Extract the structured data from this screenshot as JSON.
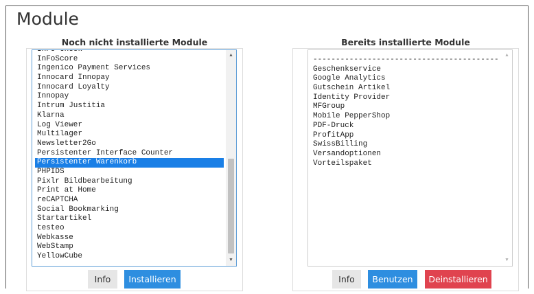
{
  "page": {
    "title": "Module"
  },
  "not_installed": {
    "heading": "Noch nicht installierte Module",
    "items": [
      "InFo-Check",
      "InFoScore",
      "Ingenico Payment Services",
      "Innocard Innopay",
      "Innocard Loyalty",
      "Innopay",
      "Intrum Justitia",
      "Klarna",
      "Log Viewer",
      "Multilager",
      "Newsletter2Go",
      "Persistenter Interface Counter",
      "Persistenter Warenkorb",
      "PHPIDS",
      "Pixlr Bildbearbeitung",
      "Print at Home",
      "reCAPTCHA",
      "Social Bookmarking",
      "Startartikel",
      "testeo",
      "Webkasse",
      "WebStamp",
      "YellowCube"
    ],
    "selected": "Persistenter Warenkorb",
    "buttons": {
      "info": "Info",
      "install": "Installieren"
    }
  },
  "installed": {
    "heading": "Bereits installierte Module",
    "separator": "-----------------------------------------",
    "items": [
      "Geschenkservice",
      "Google Analytics",
      "Gutschein Artikel",
      "Identity Provider",
      "MFGroup",
      "Mobile PepperShop",
      "PDF-Druck",
      "ProfitApp",
      "SwissBilling",
      "Versandoptionen",
      "Vorteilspaket"
    ],
    "buttons": {
      "info": "Info",
      "use": "Benutzen",
      "uninstall": "Deinstallieren"
    }
  },
  "colors": {
    "primary": "#2e8ee0",
    "danger": "#e0434f",
    "selection": "#1a7fe6",
    "neutral_button": "#e6e6e6"
  },
  "icons": {
    "scroll_up": "triangle-up-icon",
    "scroll_down": "triangle-down-icon"
  }
}
